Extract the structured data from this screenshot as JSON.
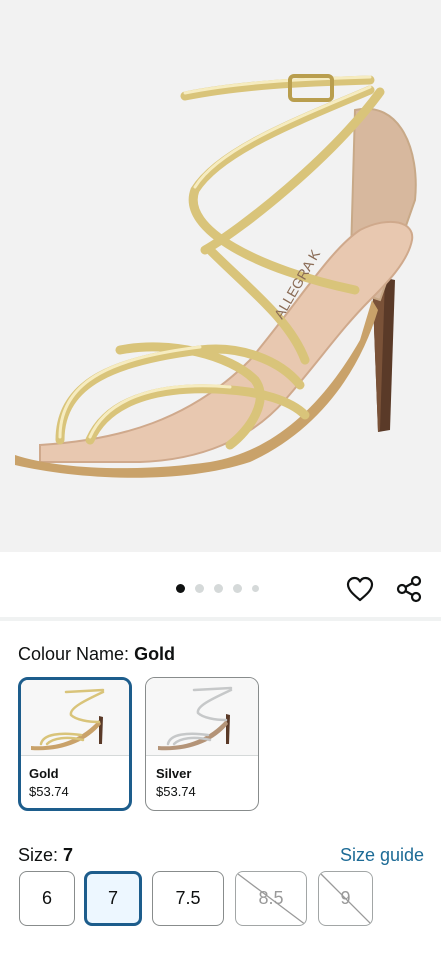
{
  "gallery": {
    "image_count": 5,
    "active_index": 0
  },
  "actions": {
    "wishlist_icon": "heart-icon",
    "share_icon": "share-icon"
  },
  "colour": {
    "label": "Colour Name:",
    "selected": "Gold",
    "options": [
      {
        "name": "Gold",
        "price": "$53.74"
      },
      {
        "name": "Silver",
        "price": "$53.74"
      }
    ]
  },
  "size": {
    "label": "Size:",
    "selected": "7",
    "guide_link": "Size guide",
    "options": [
      {
        "value": "6"
      },
      {
        "value": "7"
      },
      {
        "value": "7.5"
      },
      {
        "value": "8.5"
      },
      {
        "value": "9"
      }
    ]
  },
  "colors": {
    "accent": "#1d5d8c",
    "link": "#1d6b96",
    "gold": "#d9c47a"
  }
}
